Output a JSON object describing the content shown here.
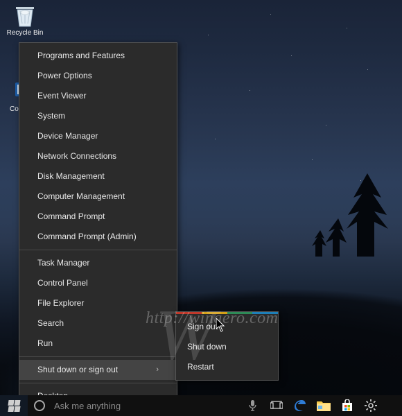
{
  "desktop": {
    "recycle_bin_label": "Recycle Bin",
    "computer_label": "Computer"
  },
  "winx_menu": {
    "groups": [
      [
        "Programs and Features",
        "Power Options",
        "Event Viewer",
        "System",
        "Device Manager",
        "Network Connections",
        "Disk Management",
        "Computer Management",
        "Command Prompt",
        "Command Prompt (Admin)"
      ],
      [
        "Task Manager",
        "Control Panel",
        "File Explorer",
        "Search",
        "Run"
      ],
      [
        "Shut down or sign out"
      ],
      [
        "Desktop"
      ]
    ],
    "expandable_index": "Shut down or sign out",
    "highlighted": "Shut down or sign out"
  },
  "shutdown_submenu": {
    "items": [
      "Sign out",
      "Shut down",
      "Restart"
    ]
  },
  "taskbar": {
    "search_placeholder": "Ask me anything",
    "icons": {
      "start": "start-button",
      "cortana": "cortana-circle",
      "mic": "microphone-icon",
      "taskview": "task-view-icon",
      "edge": "edge-icon",
      "explorer": "file-explorer-icon",
      "store": "store-icon",
      "settings": "settings-icon"
    }
  },
  "watermark": {
    "text": "http://winaero.com"
  },
  "colors": {
    "menu_bg": "#2b2b2b",
    "menu_highlight": "#444444",
    "taskbar_bg": "#101010"
  }
}
